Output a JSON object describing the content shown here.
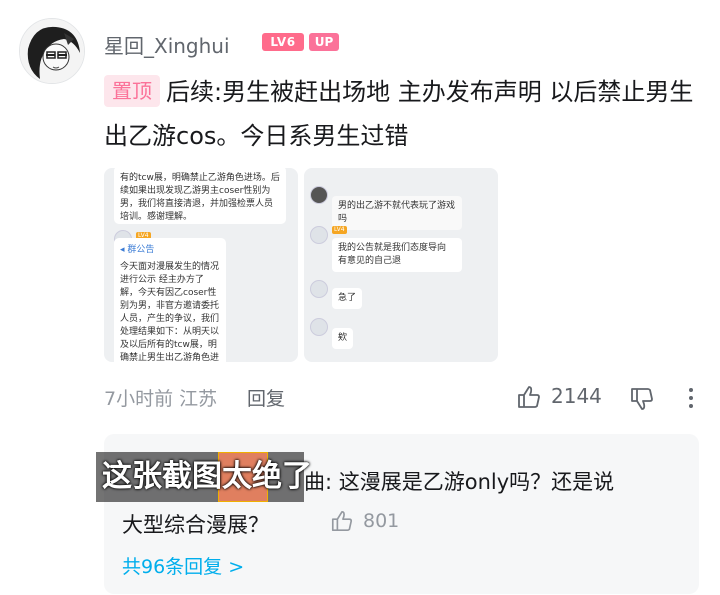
{
  "user": {
    "name": "星回_Xinghui",
    "level_badge": "LV6",
    "up_badge": "UP"
  },
  "comment": {
    "pin_label": "置顶",
    "text": "后续:男生被赶出场地 主办发布声明 以后禁止男生出乙游cos。今日系男生过错"
  },
  "images": {
    "shot1": {
      "top_text": "有的tcw展，明确禁止乙游角色进场。后续如果出现发现乙游男主coser性别为男，我们将直接清退，并加强检票人员培训。感谢理解。",
      "group_label": "群公告",
      "body_text": "今天面对漫展发生的情况进行公示 经主办方了解，今天有因乙coser性别为男，非官方邀请委托人员，产生的争议，我们处理结果如下：从明天以及以后所有的tcw展，明确禁止男生出乙游角色进场。后续如果出现发现乙游男主coser性别为男，我们将直接清退，并加强检票人员培训。感谢理解"
    },
    "shot2": {
      "msg1": "男的出乙游不就代表玩了游戏吗",
      "msg2": "我的公告就是我们态度导向 有意见的自己退",
      "msg3": "急了",
      "msg4": "欸"
    }
  },
  "meta": {
    "time_location": "7小时前 江苏",
    "reply_label": "回复",
    "like_count": "2144"
  },
  "reply": {
    "author_text": "曲: 这漫展是乙游only吗？还是说",
    "text_line2": "大型综合漫展？",
    "like_count": "801",
    "more_replies": "共96条回复 >"
  },
  "overlay": {
    "caption": "这张截图太绝了"
  },
  "colors": {
    "pink": "#fb7299",
    "link_blue": "#00aeec",
    "gray": "#9499a0"
  }
}
